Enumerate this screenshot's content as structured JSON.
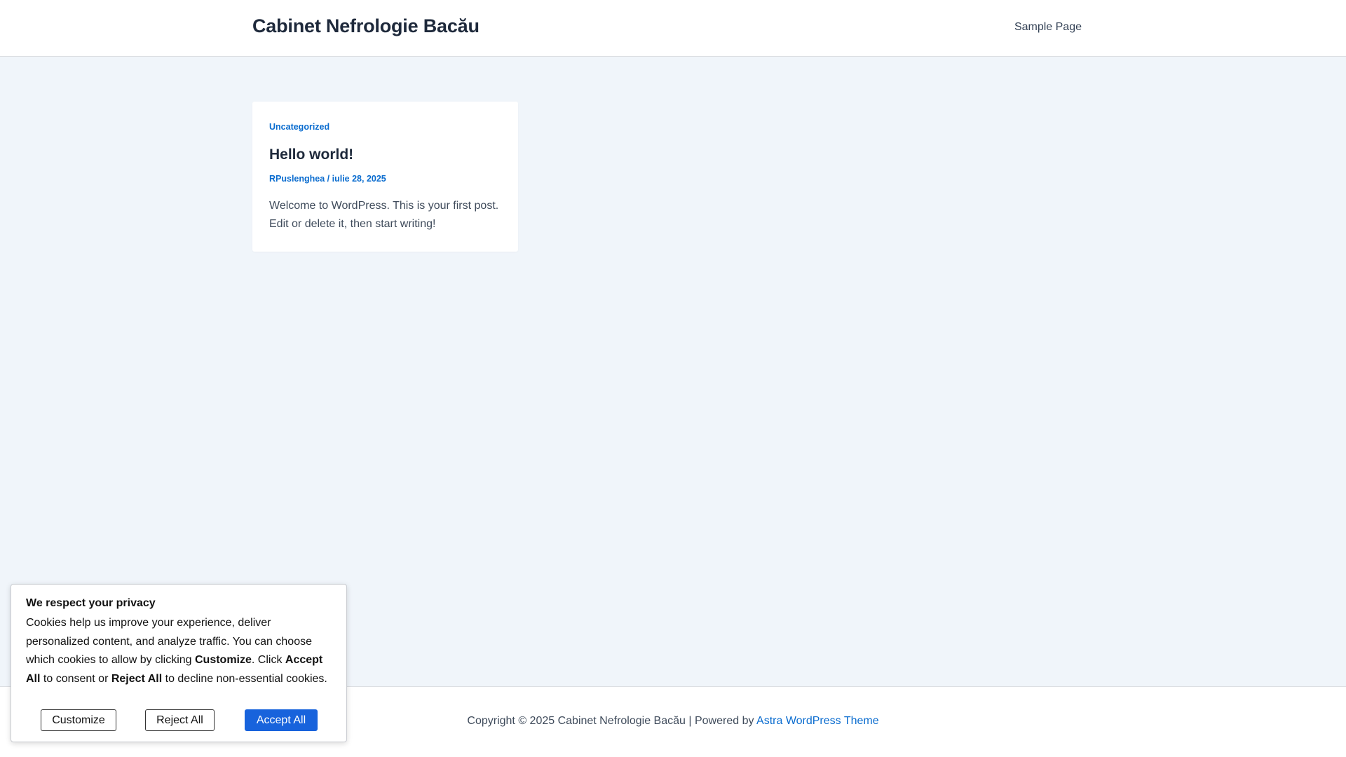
{
  "header": {
    "site_title": "Cabinet Nefrologie Bacău",
    "nav": [
      {
        "label": "Sample Page"
      }
    ]
  },
  "post": {
    "category": "Uncategorized",
    "title": "Hello world!",
    "author": "RPuslenghea",
    "separator": " / ",
    "date": "iulie 28, 2025",
    "excerpt": "Welcome to WordPress. This is your first post. Edit or delete it, then start writing!"
  },
  "footer": {
    "copyright": "Copyright © 2025 Cabinet Nefrologie Bacău | Powered by ",
    "theme_link": "Astra WordPress Theme"
  },
  "cookie_banner": {
    "title": "We respect your privacy",
    "text_1": "Cookies help us improve your experience, deliver personalized content, and analyze traffic. You can choose which cookies to allow by clicking ",
    "bold_customize": "Customize",
    "text_2": ". Click ",
    "bold_accept": "Accept All",
    "text_3": " to consent or ",
    "bold_reject": "Reject All",
    "text_4": " to decline non-essential cookies.",
    "buttons": {
      "customize": "Customize",
      "reject": "Reject All",
      "accept": "Accept All"
    }
  },
  "colors": {
    "accent": "#0a6ccf",
    "accept_button": "#1863dc",
    "background": "#f0f5fa"
  }
}
